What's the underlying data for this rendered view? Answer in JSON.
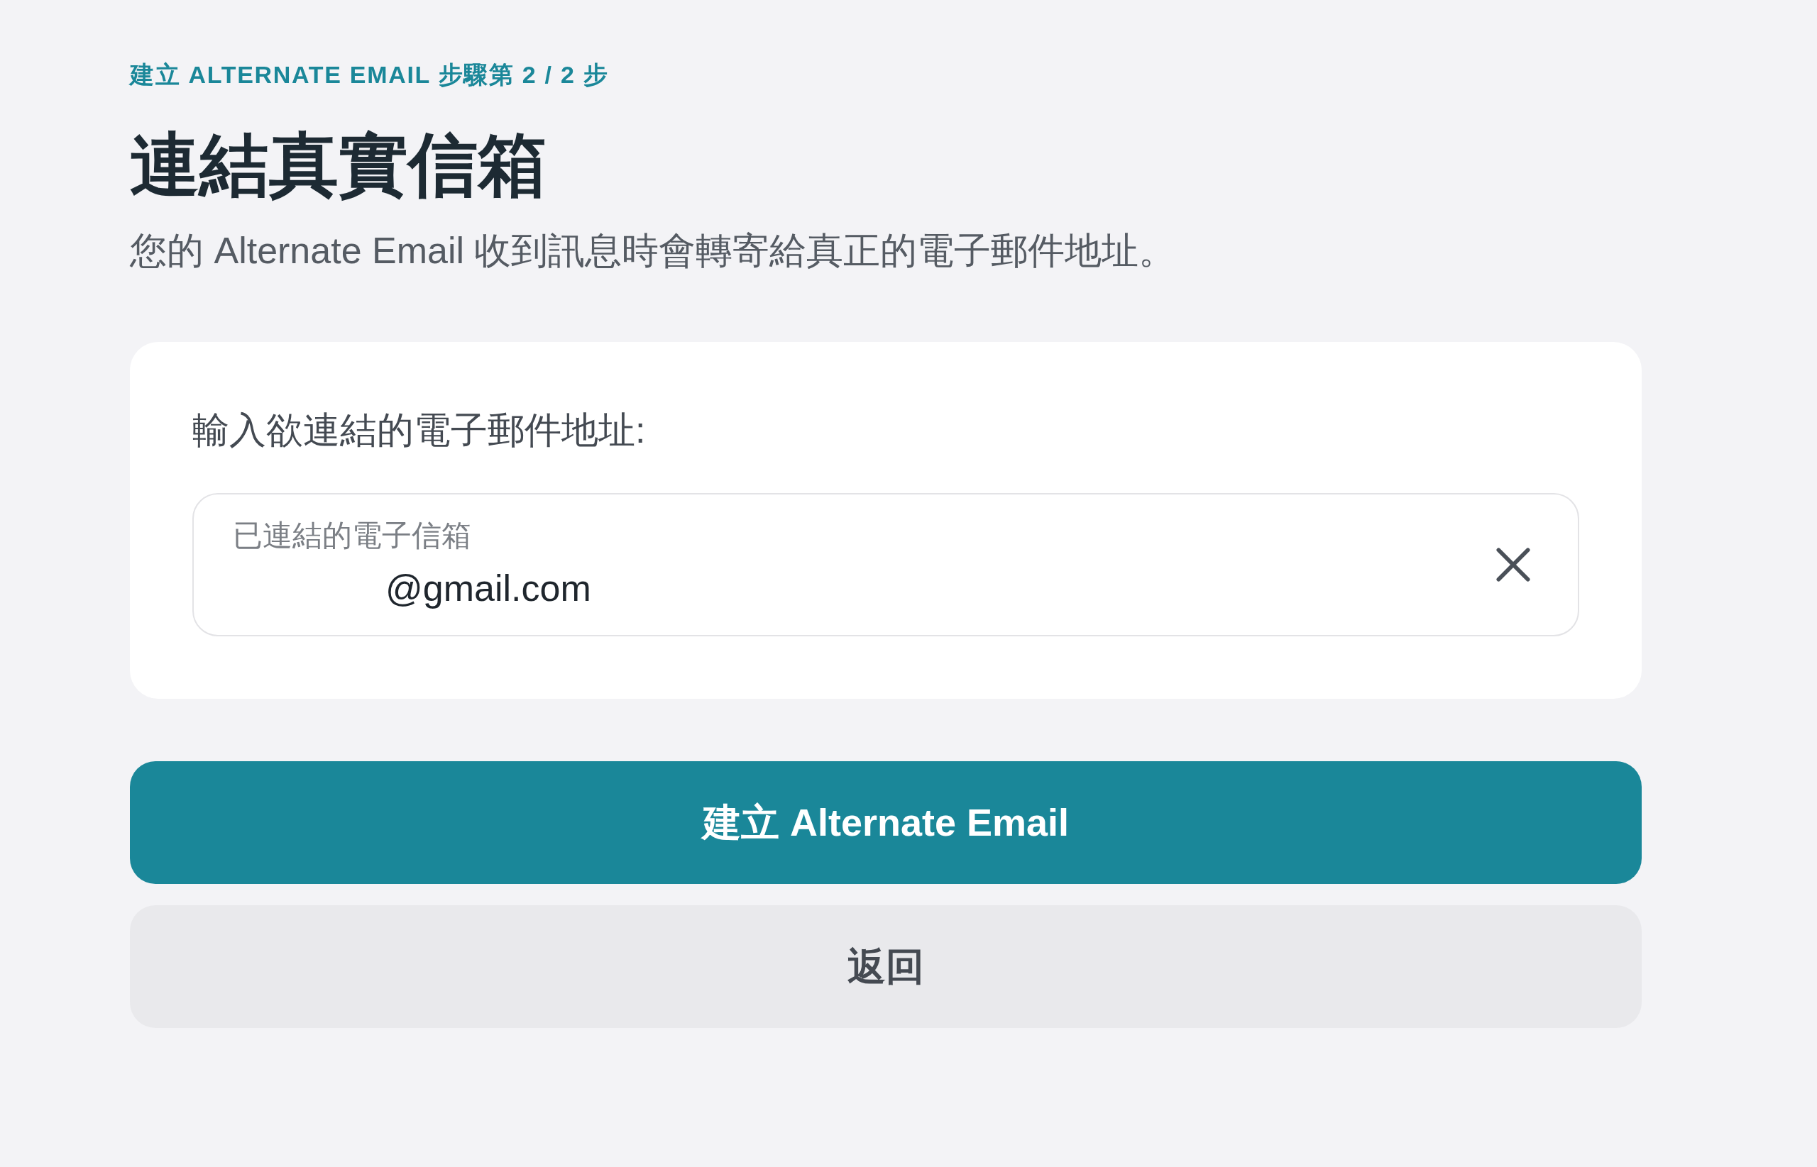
{
  "step_label": "建立 ALTERNATE EMAIL 步驟第 2 / 2 步",
  "title": "連結真實信箱",
  "description": "您的 Alternate Email 收到訊息時會轉寄給真正的電子郵件地址。",
  "card": {
    "prompt": "輸入欲連結的電子郵件地址:",
    "field": {
      "label": "已連結的電子信箱",
      "value": "@gmail.com"
    }
  },
  "buttons": [
    {
      "label": "建立 Alternate Email",
      "kind": "primary"
    },
    {
      "label": "返回",
      "kind": "secondary"
    }
  ]
}
